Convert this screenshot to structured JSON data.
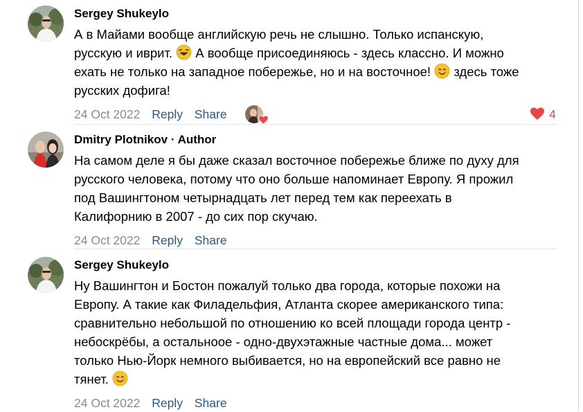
{
  "comments": [
    {
      "author": "Sergey Shukeylo",
      "separator": "",
      "role": "",
      "lines": [
        "А в Майами вообще английскую речь не слышно. Только испанскую,",
        "русскую и иврит.",
        "А вообще присоединяюсь - здесь классно. И можно",
        "ехать не только на западное побережье, но и на восточное!",
        "здесь тоже",
        "русских дофига!"
      ],
      "date": "24 Oct 2022",
      "reply_label": "Reply",
      "share_label": "Share",
      "likes": "4"
    },
    {
      "author": "Dmitry Plotnikov",
      "separator": " · ",
      "role": "Author",
      "lines": [
        "На самом деле я бы даже сказал восточное побережье ближе по духу для",
        "русского человека, потому что оно больше напоминает Европу. Я прожил",
        "под Вашингтоном четырнадцать лет перед тем как переехать в",
        "Калифорнию в 2007 - до сих пор скучаю."
      ],
      "date": "24 Oct 2022",
      "reply_label": "Reply",
      "share_label": "Share"
    },
    {
      "author": "Sergey Shukeylo",
      "separator": "",
      "role": "",
      "lines": [
        "Ну Вашингтон и Бостон пожалуй только два города, которые похожи на",
        "Европу. А такие как Филадельфия, Атланта скорее американского типа:",
        "сравнительно небольшой по отношению ко всей площади города центр -",
        "небоскрёбы, а остальноое - одно-двухэтажные частные дома... может",
        "только Нью-Йорк немного выбивается, но на европейский все равно не",
        "тянет."
      ],
      "date": "24 Oct 2022",
      "reply_label": "Reply",
      "share_label": "Share"
    }
  ],
  "colors": {
    "link": "#2a5885",
    "meta": "#818c99",
    "like": "#e64646",
    "divider": "#e1e3e6"
  },
  "icons": {
    "laughing": "rolling-on-floor-laughing-emoji",
    "smile": "smiling-face-emoji",
    "heart": "heart-icon"
  }
}
